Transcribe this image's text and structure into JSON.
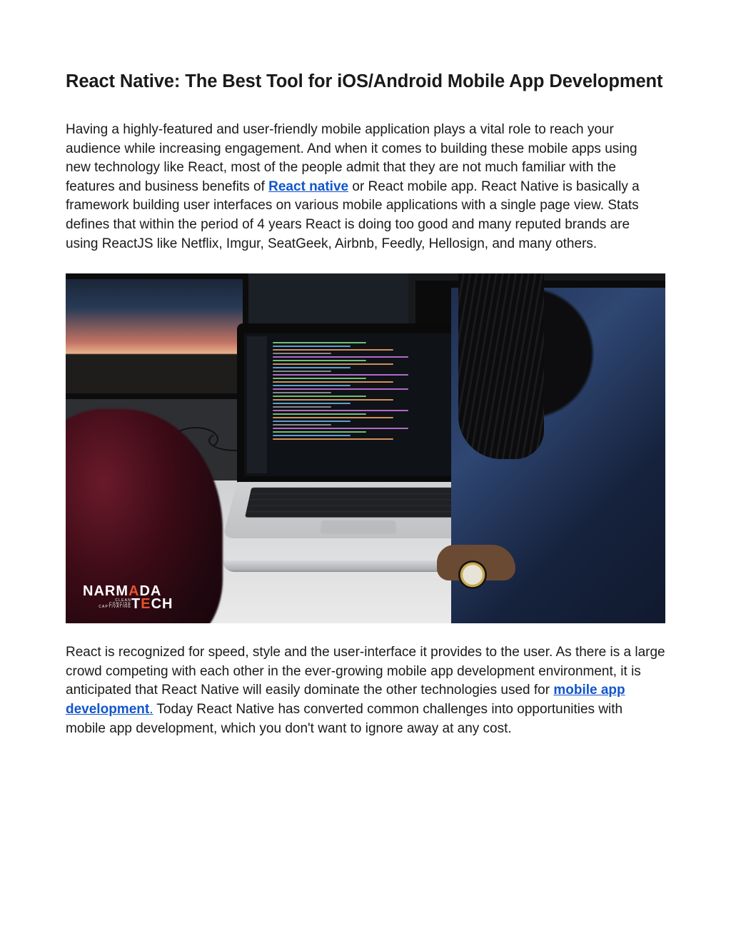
{
  "title": "React Native: The Best Tool for iOS/Android Mobile App Development",
  "paragraph1": {
    "before_link": "Having a highly-featured and user-friendly mobile application plays a vital role to reach your audience while increasing engagement. And when it comes to building these mobile apps using new technology like React, most of the people admit that they are not much familiar with the features and business benefits of ",
    "link": "React native",
    "after_link": " or React mobile app. React Native is basically a framework building user interfaces on various mobile applications with a single page view. Stats defines that within the period of 4 years React is doing too good and many reputed brands are using ReactJS like Netflix, Imgur, SeatGeek, Airbnb, Feedly, Hellosign, and many others."
  },
  "paragraph2": {
    "before_link": "React is recognized for speed, style and the user-interface it provides to the user. As there is a large crowd competing with each other in the ever-growing mobile app development environment, it is anticipated that React Native will easily dominate the other technologies used for ",
    "link": "mobile app development",
    "period": ".",
    "after_link": " Today React Native has converted common challenges into opportunities with mobile app development, which you don't want to ignore away at any cost."
  },
  "logo": {
    "line1_a": "NARM",
    "line1_accent": "A",
    "line1_b": "DA",
    "line2_a": "T",
    "line2_accent": "E",
    "line2_b": "CH",
    "tag1": "CLEAN",
    "tag2": "CONCISE",
    "tag3": "CAPTIVATING"
  }
}
